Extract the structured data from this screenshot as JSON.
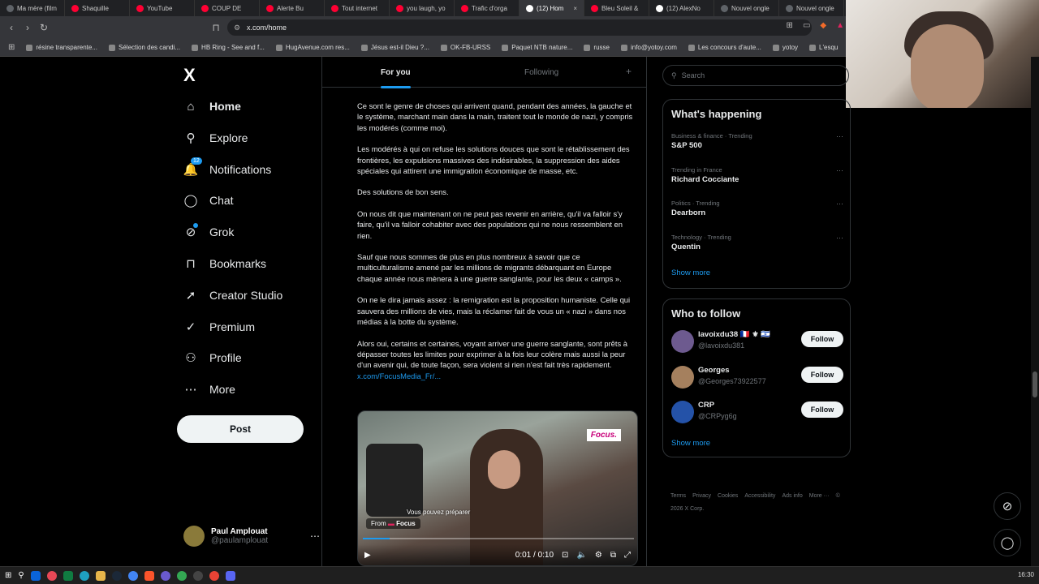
{
  "browser": {
    "tabs": [
      {
        "label": "Ma mère (film",
        "color": "#5f6368"
      },
      {
        "label": "Shaquille",
        "color": "#ff0033"
      },
      {
        "label": "YouTube",
        "color": "#ff0033"
      },
      {
        "label": "COUP DE",
        "color": "#ff0033"
      },
      {
        "label": "Alerte Bu",
        "color": "#ff0033"
      },
      {
        "label": "Tout internet",
        "color": "#ff0033"
      },
      {
        "label": "you laugh, yo",
        "color": "#ff0033"
      },
      {
        "label": "Trafic d'orga",
        "color": "#ff0033"
      },
      {
        "label": "(12) Hom",
        "color": "#ffffff"
      },
      {
        "label": "Bleu Soleil &",
        "color": "#ff0033"
      },
      {
        "label": "(12) AlexNo",
        "color": "#ffffff"
      },
      {
        "label": "Nouvel ongle",
        "color": "#5f6368"
      },
      {
        "label": "Nouvel ongle",
        "color": "#5f6368"
      }
    ],
    "active_tab_index": 8,
    "url": "x.com/home",
    "bookmarks": [
      "résine transparente...",
      "Sélection des candi...",
      "HB Ring - See and f...",
      "HugAvenue.com res...",
      "Jésus est-il Dieu ?...",
      "OK-FB-URSS",
      "Paquet NTB nature...",
      "russe",
      "info@yotoy.com",
      "Les concours d'aute...",
      "yotoy",
      "L'esqu"
    ]
  },
  "nav": {
    "logo": "X",
    "items": [
      {
        "label": "Home",
        "icon": "home-icon",
        "glyph": "⌂"
      },
      {
        "label": "Explore",
        "icon": "search-icon",
        "glyph": "⚲"
      },
      {
        "label": "Notifications",
        "icon": "bell-icon",
        "glyph": "🔔",
        "badge": "12"
      },
      {
        "label": "Chat",
        "icon": "chat-icon",
        "glyph": "◯"
      },
      {
        "label": "Grok",
        "icon": "grok-icon",
        "glyph": "⊘"
      },
      {
        "label": "Bookmarks",
        "icon": "bookmark-icon",
        "glyph": "⊓"
      },
      {
        "label": "Creator Studio",
        "icon": "rocket-icon",
        "glyph": "➚"
      },
      {
        "label": "Premium",
        "icon": "verified-icon",
        "glyph": "✓"
      },
      {
        "label": "Profile",
        "icon": "person-icon",
        "glyph": "⚇"
      },
      {
        "label": "More",
        "icon": "more-circle-icon",
        "glyph": "⋯"
      }
    ],
    "post_label": "Post",
    "account": {
      "name": "Paul Amplouat",
      "handle": "@paulamplouat"
    }
  },
  "timeline": {
    "tabs": {
      "for_you": "For you",
      "following": "Following"
    },
    "post": {
      "paragraphs": [
        "Ce sont le genre de choses qui arrivent quand, pendant des années, la gauche et le système, marchant main dans la main, traitent tout le monde de nazi, y compris les modérés (comme moi).",
        "Les modérés à qui on refuse les solutions douces que sont le rétablissement des frontières, les expulsions massives des indésirables, la suppression des aides spéciales qui attirent une immigration économique de masse, etc.",
        "Des solutions de bon sens.",
        "On nous dit que maintenant on ne peut pas revenir en arrière, qu'il va falloir s'y faire, qu'il va falloir cohabiter avec des populations qui ne nous ressemblent en rien.",
        "Sauf que nous sommes de plus en plus nombreux à savoir que ce multiculturalisme amené par les millions de migrants débarquant en Europe chaque année nous mènera à une guerre sanglante, pour les deux « camps ».",
        "On ne le dira jamais assez : la remigration est la proposition humaniste. Celle qui sauvera des millions de vies, mais la réclamer fait de vous un « nazi » dans nos médias à la botte du système."
      ],
      "last_paragraph": "Alors oui, certains et certaines, voyant arriver une guerre sanglante, sont prêts à dépasser toutes les limites pour exprimer à la fois leur colère mais aussi la peur d'un avenir qui, de toute façon, sera violent si rien n'est fait très rapidement.",
      "link": "x.com/FocusMedia_Fr/...",
      "video": {
        "badge": "Focus.",
        "caption": "Vous pouvez préparer",
        "from_prefix": "From",
        "from_source": "Focus",
        "time": "0:01 / 0:10",
        "progress_fraction": 0.1
      }
    }
  },
  "sidebar": {
    "search_placeholder": "Search",
    "trends_title": "What's happening",
    "trends": [
      {
        "category": "Business & finance · Trending",
        "name": "S&P 500"
      },
      {
        "category": "Trending in France",
        "name": "Richard Cocciante"
      },
      {
        "category": "Politics · Trending",
        "name": "Dearborn"
      },
      {
        "category": "Technology · Trending",
        "name": "Quentin"
      }
    ],
    "trends_show_more": "Show more",
    "follow_title": "Who to follow",
    "follow": [
      {
        "name": "lavoixdu38 🇫🇷 ⚜ 🇮🇱",
        "handle": "@lavoixdu381",
        "button": "Follow",
        "avatar_color": "#6d5a8f"
      },
      {
        "name": "Georges",
        "handle": "@Georges73922577",
        "button": "Follow",
        "avatar_color": "#a5805e"
      },
      {
        "name": "CRP",
        "handle": "@CRPyg6g",
        "button": "Follow",
        "avatar_color": "#2452a8"
      }
    ],
    "follow_show_more": "Show more",
    "footer": [
      "Terms",
      "Privacy",
      "Cookies",
      "Accessibility",
      "Ads info",
      "More ···",
      "© 2026 X Corp."
    ]
  },
  "taskbar": {
    "clock": "16:30"
  },
  "colors": {
    "accent": "#1d9bf0",
    "background": "#000000",
    "border": "#2f3336",
    "muted": "#71767b"
  }
}
